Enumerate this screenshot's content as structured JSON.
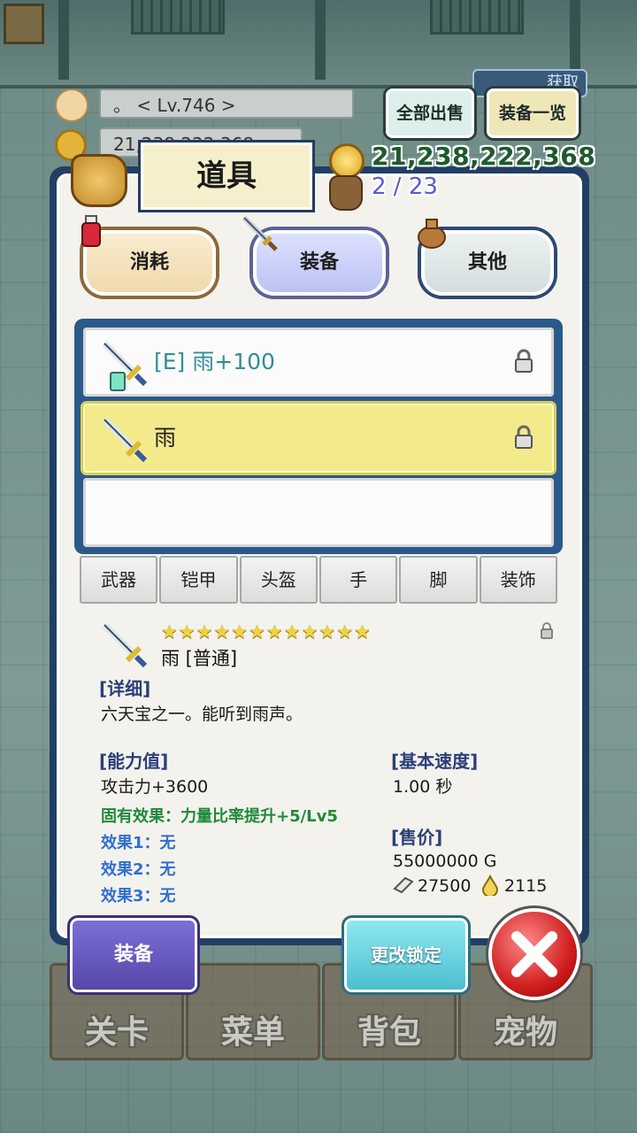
{
  "hud": {
    "level": "。    < Lv.746 >",
    "gold_small": "21,238,222,368",
    "gold": "21,238,222,368",
    "bag_count": "2 / 23",
    "get_badge": "获取"
  },
  "top_buttons": {
    "sell_all": "全部出售",
    "equip_list": "装备一览"
  },
  "panel": {
    "title": "道具"
  },
  "category_tabs": [
    {
      "label": "消耗"
    },
    {
      "label": "装备"
    },
    {
      "label": "其他"
    }
  ],
  "items": [
    {
      "name": "[E] 雨+100",
      "locked": true
    },
    {
      "name": "雨",
      "locked": true
    },
    {
      "name": "",
      "locked": false
    }
  ],
  "sub_tabs": [
    "武器",
    "铠甲",
    "头盔",
    "手",
    "脚",
    "装饰"
  ],
  "detail": {
    "stars": "★★★★★★★★★★★★",
    "name": "雨 [普通]",
    "detail_header": "[详细]",
    "description": "六天宝之一。能听到雨声。",
    "ability_header": "[能力值]",
    "attack": "攻击力+3600",
    "innate": "固有效果：力量比率提升+5/Lv5",
    "effect1": "效果1：无",
    "effect2": "效果2：无",
    "effect3": "效果3：无",
    "speed_header": "[基本速度]",
    "speed": "1.00 秒",
    "price_header": "[售价]",
    "price": "55000000 G",
    "stone": "27500",
    "drop": "2115"
  },
  "actions": {
    "equip": "装备",
    "change_lock": "更改锁定"
  },
  "nav": [
    "关卡",
    "菜单",
    "背包",
    "宠物"
  ]
}
